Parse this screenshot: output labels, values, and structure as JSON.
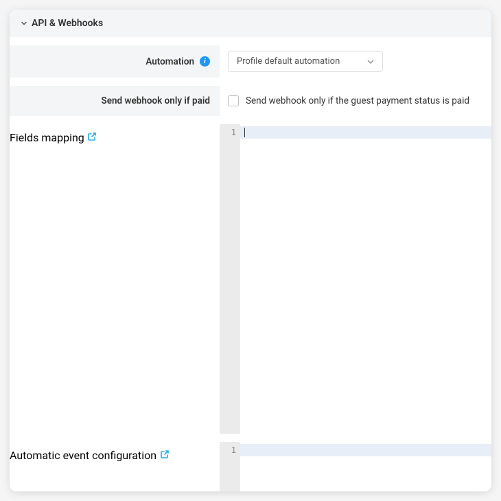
{
  "section": {
    "title": "API & Webhooks",
    "expanded": true
  },
  "rows": {
    "automation": {
      "label": "Automation",
      "selected": "Profile default automation"
    },
    "webhook_paid": {
      "label": "Send webhook only if paid",
      "checkbox_checked": false,
      "description": "Send webhook only if the guest payment status is paid"
    },
    "fields_mapping": {
      "label": "Fields mapping",
      "editor": {
        "line_numbers": [
          "1"
        ],
        "content": ""
      }
    },
    "auto_event_config": {
      "label": "Automatic event configuration",
      "editor": {
        "line_numbers": [
          "1"
        ],
        "content": ""
      }
    }
  }
}
